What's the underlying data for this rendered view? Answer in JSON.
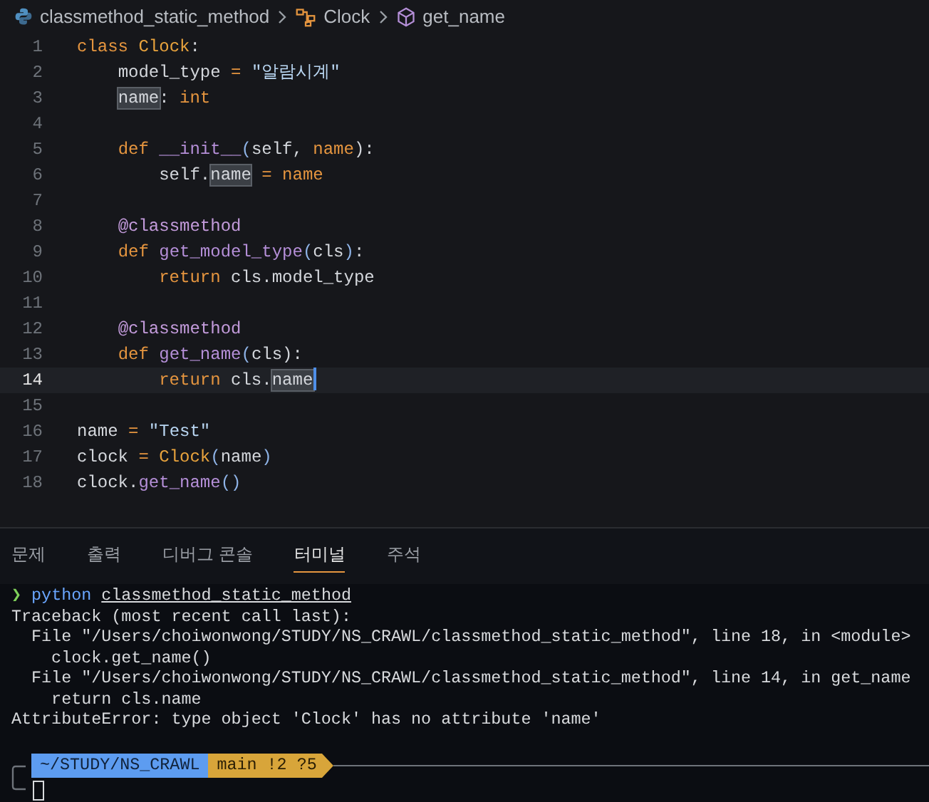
{
  "breadcrumb": [
    {
      "kind": "file",
      "label": "classmethod_static_method"
    },
    {
      "kind": "class",
      "label": "Clock"
    },
    {
      "kind": "method",
      "label": "get_name"
    }
  ],
  "editor": {
    "lines": [
      {
        "number": "1",
        "current": false,
        "tokens": [
          {
            "t": "class ",
            "kind": "kw"
          },
          {
            "t": "Clock",
            "kind": "cls"
          },
          {
            "t": ":",
            "kind": "plain"
          }
        ]
      },
      {
        "number": "2",
        "current": false,
        "tokens": [
          {
            "t": "    model_type ",
            "kind": "plain"
          },
          {
            "t": "=",
            "kind": "op"
          },
          {
            "t": " \"알람시계\"",
            "kind": "str"
          }
        ]
      },
      {
        "number": "3",
        "current": false,
        "tokens": [
          {
            "t": "    name",
            "kind": "hl"
          },
          {
            "t": ": ",
            "kind": "plain"
          },
          {
            "t": "int",
            "kind": "kw"
          }
        ]
      },
      {
        "number": "4",
        "current": false
      },
      {
        "number": "5",
        "current": false,
        "tokens": [
          {
            "t": "    def ",
            "kind": "kw"
          },
          {
            "t": "__init__",
            "kind": "fn"
          },
          {
            "t": "(",
            "kind": "punct"
          },
          {
            "t": "self, ",
            "kind": "plain"
          },
          {
            "t": "name",
            "kind": "kw"
          },
          {
            "t": "):",
            "kind": "plain"
          }
        ]
      },
      {
        "number": "6",
        "current": false,
        "tokens": [
          {
            "t": "        self.",
            "kind": "plain"
          },
          {
            "t": "name",
            "kind": "hl"
          },
          {
            "t": " = ",
            "kind": "op"
          },
          {
            "t": "name",
            "kind": "kw"
          }
        ]
      },
      {
        "number": "7",
        "current": false
      },
      {
        "number": "8",
        "current": false,
        "tokens": [
          {
            "t": "    @classmethod",
            "kind": "deco"
          }
        ]
      },
      {
        "number": "9",
        "current": false,
        "tokens": [
          {
            "t": "    def ",
            "kind": "kw"
          },
          {
            "t": "get_model_type",
            "kind": "fn"
          },
          {
            "t": "(",
            "kind": "punct"
          },
          {
            "t": "cls",
            "kind": "plain"
          },
          {
            "t": ")",
            "kind": "punct"
          },
          {
            "t": ":",
            "kind": "plain"
          }
        ]
      },
      {
        "number": "10",
        "current": false,
        "tokens": [
          {
            "t": "        return ",
            "kind": "kw"
          },
          {
            "t": "cls.model_type",
            "kind": "plain"
          }
        ]
      },
      {
        "number": "11",
        "current": false
      },
      {
        "number": "12",
        "current": false,
        "tokens": [
          {
            "t": "    @classmethod",
            "kind": "deco"
          }
        ]
      },
      {
        "number": "13",
        "current": false,
        "tokens": [
          {
            "t": "    def ",
            "kind": "kw"
          },
          {
            "t": "get_name",
            "kind": "fn"
          },
          {
            "t": "(",
            "kind": "punct"
          },
          {
            "t": "cls",
            "kind": "plain"
          },
          {
            "t": "):",
            "kind": "plain"
          }
        ]
      },
      {
        "number": "14",
        "current": true,
        "tokens": [
          {
            "t": "        return ",
            "kind": "kw"
          },
          {
            "t": "cls.",
            "kind": "plain"
          },
          {
            "t": "name",
            "kind": "hl"
          }
        ]
      },
      {
        "number": "15",
        "current": false
      },
      {
        "number": "16",
        "current": false,
        "tokens": [
          {
            "t": "name ",
            "kind": "plain"
          },
          {
            "t": "=",
            "kind": "op"
          },
          {
            "t": " \"Test\"",
            "kind": "str"
          }
        ]
      },
      {
        "number": "17",
        "current": false,
        "tokens": [
          {
            "t": "clock ",
            "kind": "plain"
          },
          {
            "t": "=",
            "kind": "op"
          },
          {
            "t": " Clock",
            "kind": "cls"
          },
          {
            "t": "(",
            "kind": "punct"
          },
          {
            "t": "name",
            "kind": "plain"
          },
          {
            "t": ")",
            "kind": "punct"
          }
        ]
      },
      {
        "number": "18",
        "current": false,
        "tokens": [
          {
            "t": "clock.",
            "kind": "plain"
          },
          {
            "t": "get_name",
            "kind": "fn"
          },
          {
            "t": "()",
            "kind": "punct"
          }
        ]
      }
    ]
  },
  "panel_tabs": [
    {
      "label": "문제",
      "selected": false
    },
    {
      "label": "출력",
      "selected": false
    },
    {
      "label": "디버그 콘솔",
      "selected": false
    },
    {
      "label": "터미널",
      "selected": true
    },
    {
      "label": "주석",
      "selected": false
    }
  ],
  "terminal": {
    "prompt_symbol": "❯",
    "command": "python",
    "argument": "classmethod_static_method",
    "output": [
      "Traceback (most recent call last):",
      "  File \"/Users/choiwonwong/STUDY/NS_CRAWL/classmethod_static_method\", line 18, in <module>",
      "    clock.get_name()",
      "  File \"/Users/choiwonwong/STUDY/NS_CRAWL/classmethod_static_method\", line 14, in get_name",
      "    return cls.name",
      "AttributeError: type object 'Clock' has no attribute 'name'"
    ],
    "path": "~/STUDY/NS_CRAWL",
    "git": "main !2 ?5"
  }
}
